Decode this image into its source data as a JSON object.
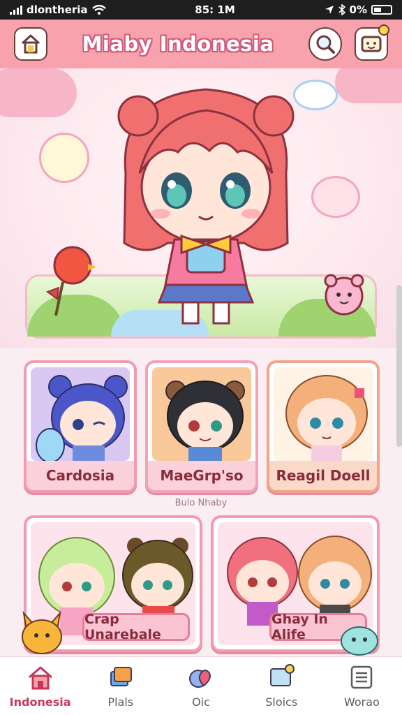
{
  "status_bar": {
    "carrier": "dlontheria",
    "time": "85: 1M",
    "battery": "0%"
  },
  "header": {
    "title": "Miaby Indonesia",
    "home_icon": "home-icon",
    "search_icon": "search-icon",
    "notifications_icon": "message-box-icon"
  },
  "colors": {
    "header": "#f7a2ad",
    "accent": "#c9365a",
    "card_border": "#f29bb0"
  },
  "cards_row1": [
    {
      "label": "Cardosia",
      "bg": "#d9c9f2"
    },
    {
      "label": "MaeGrp'so",
      "bg": "#f9c99b"
    },
    {
      "label": "Reagil Doell",
      "bg": "#fff3e6"
    }
  ],
  "section_label": "Bulo Nhaby",
  "cards_row2": [
    {
      "label": "Crap Unarebale",
      "bg": "#fde4ec"
    },
    {
      "label": "Ghay In Alife",
      "bg": "#fde4ec"
    }
  ],
  "nav": [
    {
      "label": "Indonesia",
      "icon": "home-icon",
      "active": true
    },
    {
      "label": "Plals",
      "icon": "cards-icon",
      "active": false
    },
    {
      "label": "Oic",
      "icon": "hearts-icon",
      "active": false
    },
    {
      "label": "Sloics",
      "icon": "screen-icon",
      "active": false
    },
    {
      "label": "Worao",
      "icon": "list-icon",
      "active": false
    }
  ]
}
